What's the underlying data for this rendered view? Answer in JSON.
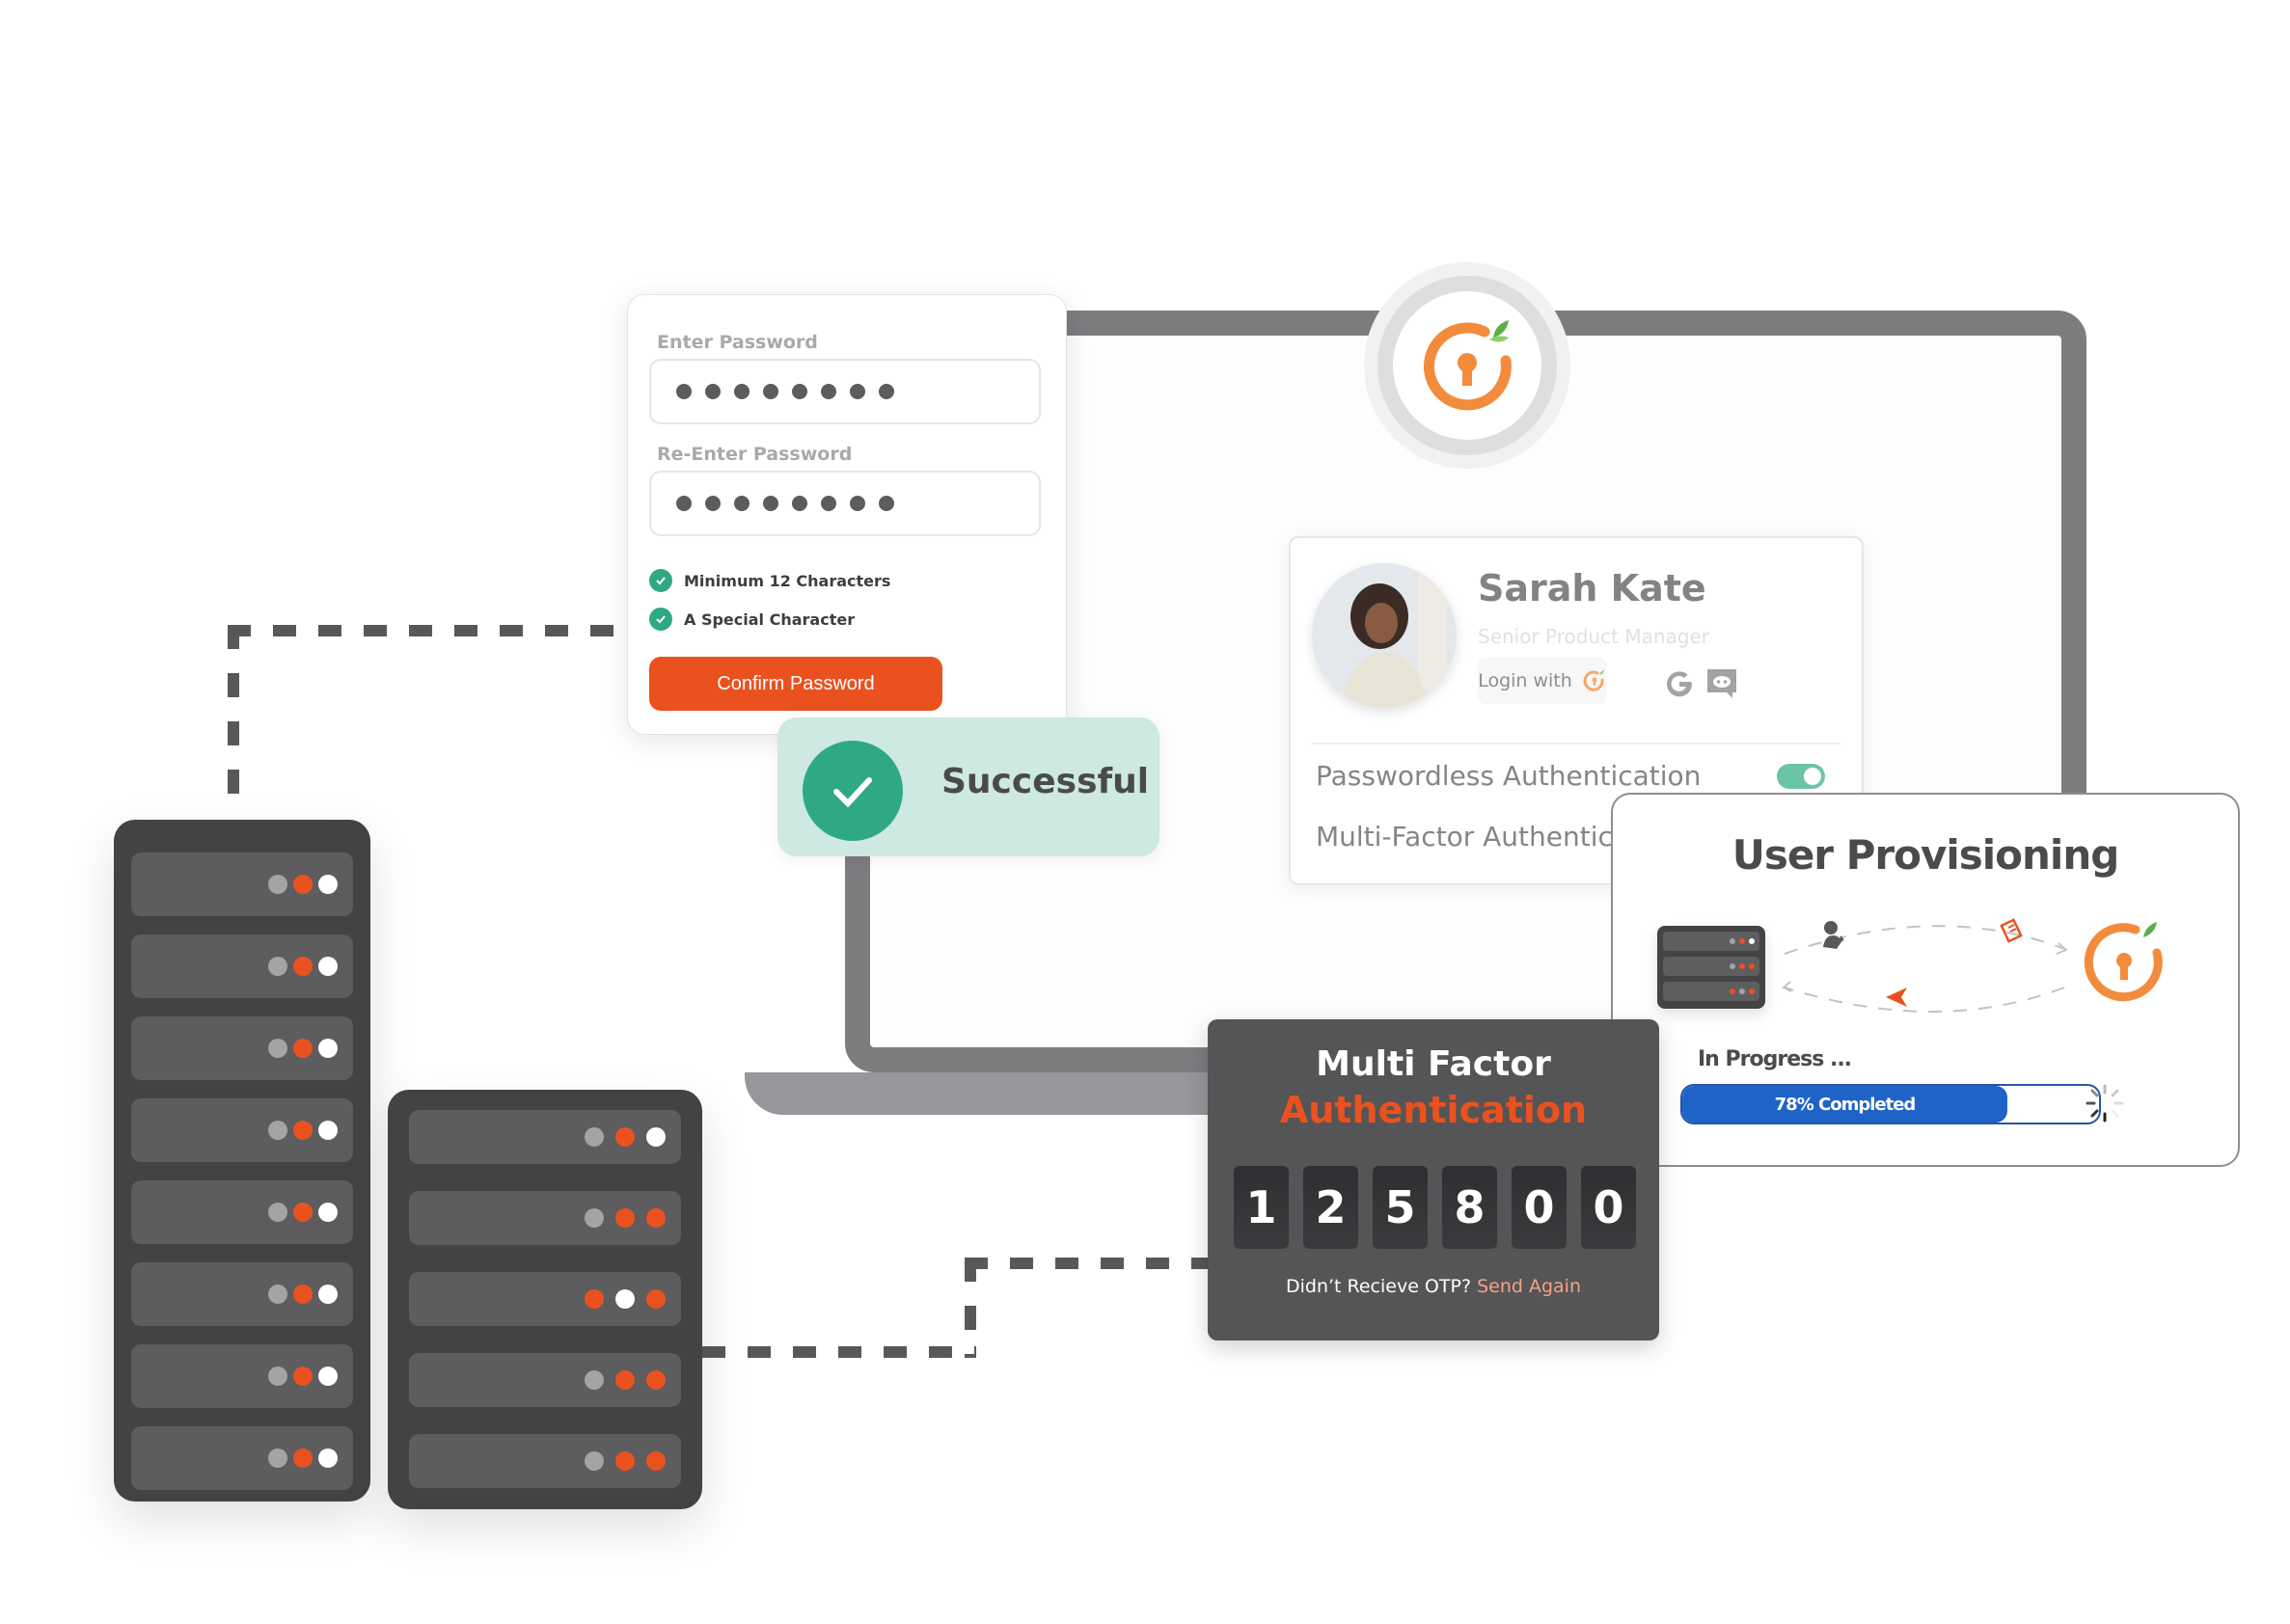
{
  "colors": {
    "accent": "#e9521f",
    "success": "#2fa985",
    "success_bg": "#cde9e1",
    "progress": "#1f63c6",
    "led_gray": "#a4a3a6",
    "led_orange": "#e9521f",
    "led_white": "#ffffff",
    "logo_orange": "#f28c3c",
    "logo_leaf": "#5cae4c"
  },
  "password_card": {
    "enter_label": "Enter Password",
    "reenter_label": "Re-Enter Password",
    "enter_masked_length": 8,
    "reenter_masked_length": 8,
    "requirements": [
      {
        "label": "Minimum 12 Characters",
        "met": true
      },
      {
        "label": "A Special Character",
        "met": true
      }
    ],
    "confirm_button": "Confirm Password"
  },
  "success_badge": {
    "label": "Successful"
  },
  "profile_card": {
    "name": "Sarah Kate",
    "role": "Senior Product Manager",
    "login_with_label": "Login with",
    "social_icons": [
      "google-icon",
      "discord-icon"
    ],
    "options": [
      {
        "label": "Passwordless Authentication",
        "enabled": true
      },
      {
        "label": "Multi-Factor Authentication"
      }
    ]
  },
  "provisioning_card": {
    "title": "User Provisioning",
    "status": "In Progress ...",
    "progress_percent": 78,
    "progress_text": "78% Completed",
    "mini_rack_rows": [
      [
        "gray",
        "orange",
        "white"
      ],
      [
        "gray",
        "orange",
        "orange"
      ],
      [
        "orange",
        "gray",
        "orange"
      ]
    ]
  },
  "mfa_card": {
    "title_line1": "Multi Factor",
    "title_line2": "Authentication",
    "otp_digits": [
      "1",
      "2",
      "5",
      "8",
      "0",
      "0"
    ],
    "footer_prefix": "Didn’t Recieve OTP?",
    "footer_link": "Send Again"
  },
  "rack_left": {
    "rows": [
      [
        "gray",
        "orange",
        "white"
      ],
      [
        "gray",
        "orange",
        "white"
      ],
      [
        "gray",
        "orange",
        "white"
      ],
      [
        "gray",
        "orange",
        "white"
      ],
      [
        "gray",
        "orange",
        "white"
      ],
      [
        "gray",
        "orange",
        "white"
      ],
      [
        "gray",
        "orange",
        "white"
      ],
      [
        "gray",
        "orange",
        "white"
      ]
    ]
  },
  "rack_right": {
    "rows": [
      [
        "gray",
        "orange",
        "white"
      ],
      [
        "gray",
        "orange",
        "orange"
      ],
      [
        "orange",
        "white",
        "orange"
      ],
      [
        "gray",
        "orange",
        "orange"
      ],
      [
        "gray",
        "orange",
        "orange"
      ]
    ]
  }
}
